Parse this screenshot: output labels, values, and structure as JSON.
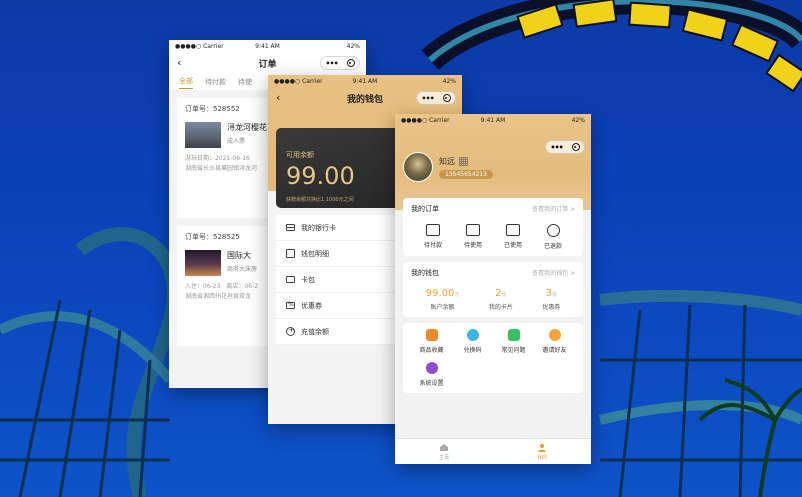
{
  "status": {
    "carrier": "●●●●○ Carrier",
    "time": "9:41 AM",
    "battery": "42%"
  },
  "orders": {
    "title": "订单",
    "tabs": [
      "全部",
      "待付款",
      "待使"
    ],
    "items": [
      {
        "order_no": "订单号：528552",
        "name": "浔龙河樱花",
        "type": "成人票",
        "meta1": "游玩日期：2021-06-16",
        "meta2": "湖南省长沙县果园镇浔龙河"
      },
      {
        "order_no": "订单号：528525",
        "name": "国际大",
        "type": "商务大床房",
        "meta1": "入住：06-23　离店：06-2",
        "meta2": "湖南省湘西州花垣县双龙"
      }
    ]
  },
  "wallet": {
    "title": "我的钱包",
    "card_label": "可用余额",
    "card_amount": "99.00",
    "card_note": "获赠余额兑换比1:1000元之间",
    "menu": [
      "我的银行卡",
      "钱包明细",
      "卡包",
      "优惠券",
      "充值余额"
    ]
  },
  "profile": {
    "name": "知远",
    "phone": "13545654213",
    "orders_title": "我的订单",
    "orders_more": "查看我的订单 >",
    "order_states": [
      "待付款",
      "待使用",
      "已使用",
      "已退款"
    ],
    "wallet_title": "我的钱包",
    "wallet_more": "查看我的钱包 >",
    "stats": [
      {
        "value": "99.00",
        "unit": "元",
        "label": "账户余额"
      },
      {
        "value": "2",
        "unit": "张",
        "label": "我的卡片"
      },
      {
        "value": "3",
        "unit": "张",
        "label": "优惠券"
      }
    ],
    "services": [
      "商品收藏",
      "兑换码",
      "常见问题",
      "邀请好友",
      "系统设置"
    ],
    "service_colors": [
      "#f08a2c",
      "#3db5e6",
      "#38c160",
      "#f2a33a",
      "#8a4fd6"
    ],
    "tabbar": [
      "主页",
      "我的"
    ]
  }
}
